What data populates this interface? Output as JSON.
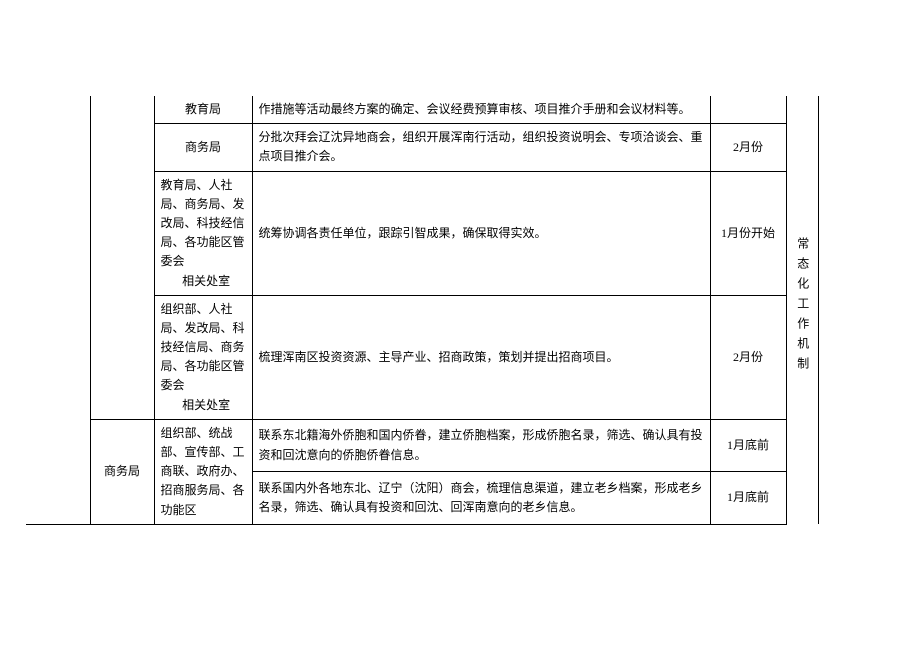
{
  "rows": [
    {
      "c": "教育局",
      "d": "作措施等活动最终方案的确定、会议经费预算审核、项目推介手册和会议材料等。",
      "e": ""
    },
    {
      "c": "商务局",
      "d": "分批次拜会辽沈异地商会，组织开展浑南行活动，组织投资说明会、专项洽谈会、重点项目推介会。",
      "e": "2月份"
    },
    {
      "c_main": "教育局、人社局、商务局、发改局、科技经信局、各功能区管委会",
      "c_sub": "相关处室",
      "d": "统筹协调各责任单位，跟踪引智成果，确保取得实效。",
      "e": "1月份开始"
    },
    {
      "c_main": "组织部、人社局、发改局、科技经信局、商务局、各功能区管委会",
      "c_sub": "相关处室",
      "d": "梳理浑南区投资资源、主导产业、招商政策，策划并提出招商项目。",
      "e": "2月份"
    },
    {
      "b": "商务局",
      "c_main": "组织部、统战部、宣传部、工商联、政府办、招商服务局、各功能区",
      "d1": "联系东北籍海外侨胞和国内侨眷，建立侨胞档案，形成侨胞名录，筛选、确认具有投资和回沈意向的侨胞侨眷信息。",
      "e1": "1月底前",
      "d2": "联系国内外各地东北、辽宁（沈阳）商会，梳理信息渠道，建立老乡档案，形成老乡名录，筛选、确认具有投资和回沈、回浑南意向的老乡信息。",
      "e2": "1月底前"
    }
  ],
  "side": "常态化工作机制"
}
